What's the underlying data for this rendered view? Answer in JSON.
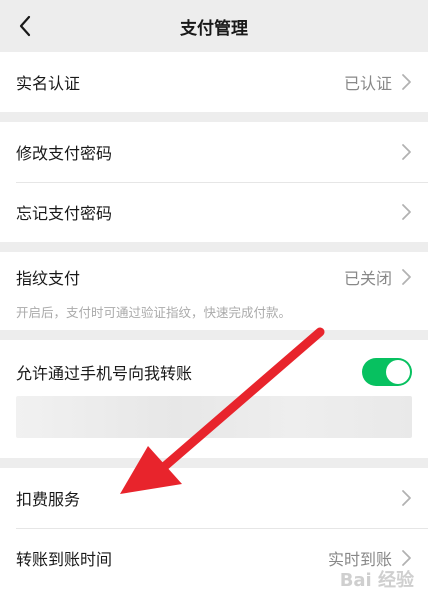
{
  "header": {
    "title": "支付管理",
    "back_icon": "chevron-left-icon"
  },
  "real_name": {
    "label": "实名认证",
    "value": "已认证"
  },
  "password": {
    "modify_label": "修改支付密码",
    "forget_label": "忘记支付密码"
  },
  "fingerprint": {
    "label": "指纹支付",
    "value": "已关闭",
    "hint": "开启后，支付时可通过验证指纹，快速完成付款。"
  },
  "phone_transfer": {
    "label": "允许通过手机号向我转账",
    "enabled": true
  },
  "services": {
    "deduction_label": "扣费服务",
    "arrival_label": "转账到账时间",
    "arrival_value": "实时到账"
  },
  "watermark": {
    "text": "Bai 经验"
  },
  "colors": {
    "toggle_on": "#07c160",
    "arrow": "#e8242c"
  }
}
